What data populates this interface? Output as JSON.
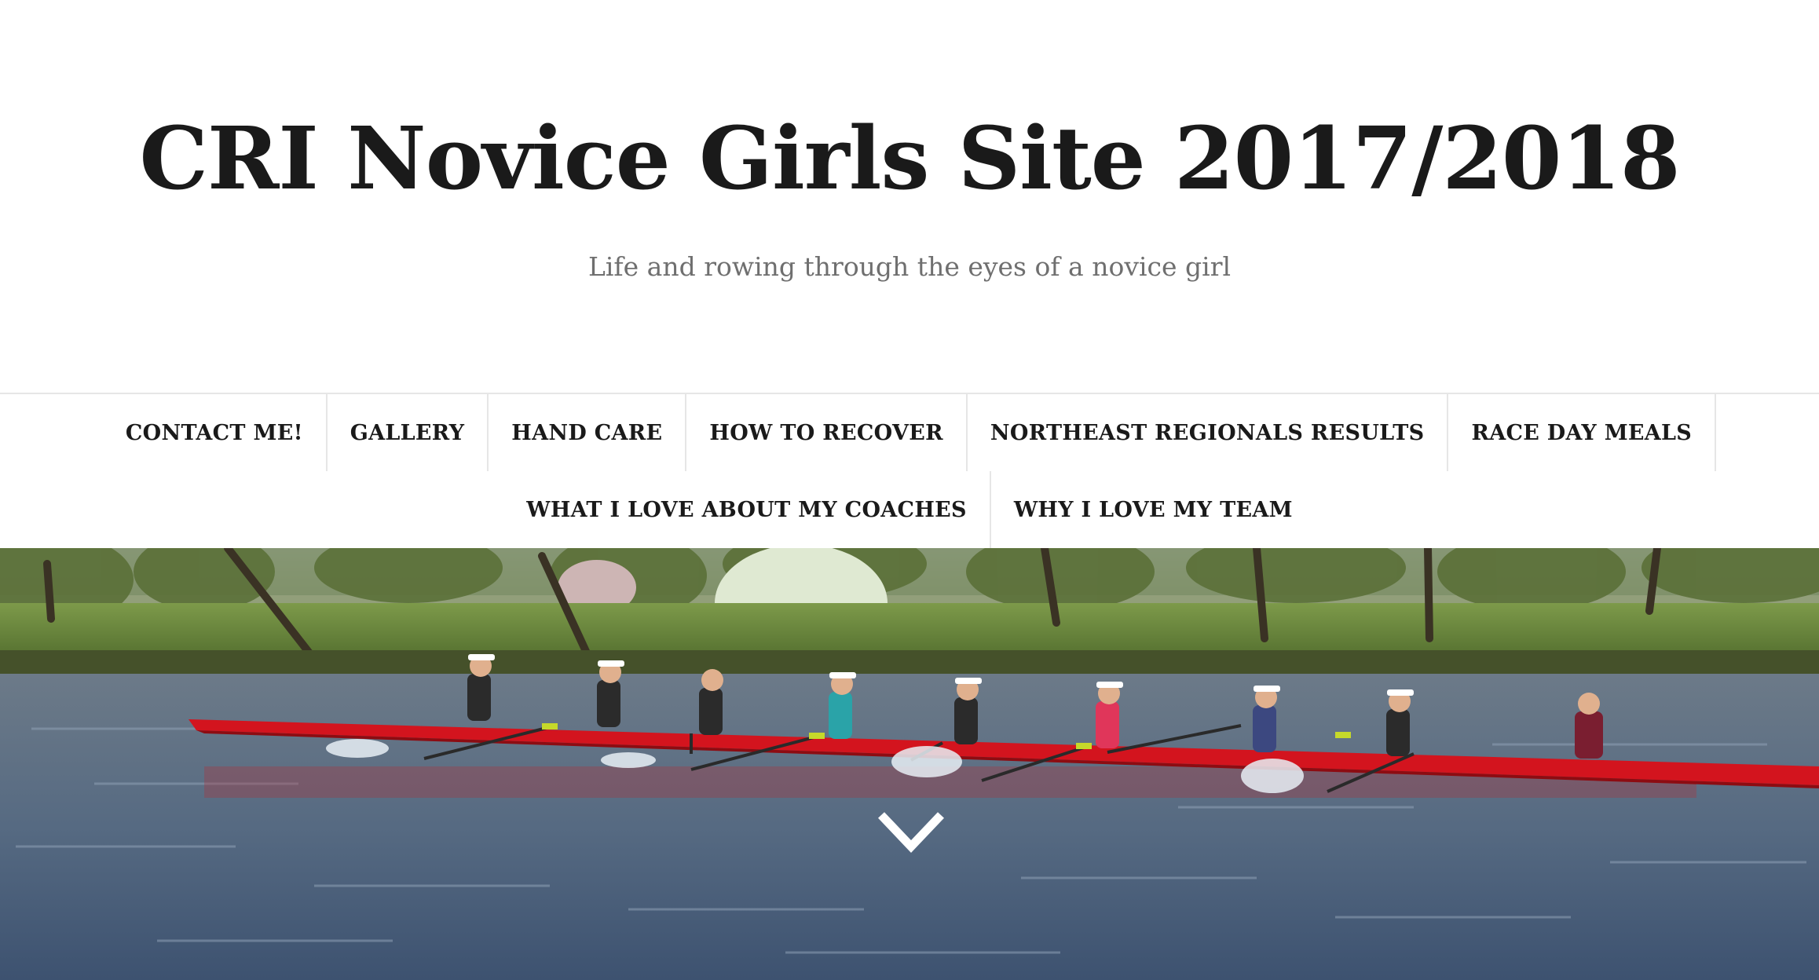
{
  "site": {
    "title": "CRI Novice Girls Site 2017/2018",
    "tagline": "Life and rowing through the eyes of a novice girl"
  },
  "nav": {
    "row1": [
      "CONTACT ME!",
      "GALLERY",
      "HAND CARE",
      "HOW TO RECOVER",
      "NORTHEAST REGIONALS RESULTS",
      "RACE DAY MEALS"
    ],
    "row2": [
      "WHAT I LOVE ABOUT MY COACHES",
      "WHY I LOVE MY TEAM"
    ]
  },
  "hero": {
    "image_description_icon": "rowing-eight-photo",
    "scroll_icon": "chevron-down-icon"
  },
  "colors": {
    "title": "#1a1a1a",
    "tagline": "#6f6f6f",
    "nav_text": "#1a1a1a",
    "nav_border": "#e6e6e6",
    "boat": "#d3141e",
    "water": "#5f6f84"
  }
}
